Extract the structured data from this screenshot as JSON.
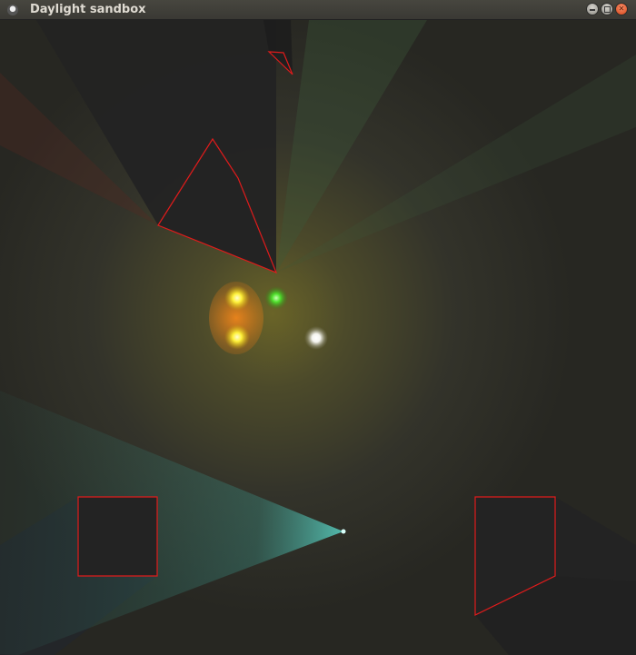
{
  "window": {
    "title": "Daylight sandbox",
    "app_icon": "app-icon",
    "controls": [
      {
        "name": "minimize-button",
        "icon": "minimize-icon"
      },
      {
        "name": "maximize-button",
        "icon": "maximize-icon"
      },
      {
        "name": "close-button",
        "icon": "close-icon"
      }
    ]
  },
  "scene": {
    "background_color": "#2a2a22",
    "obstacle_outline_color": "#e01b1b",
    "obstacle_fill_color": "#232323",
    "lights": [
      {
        "name": "yellow-light-top",
        "color": "#fff23a"
      },
      {
        "name": "green-light",
        "color": "#4fe02c"
      },
      {
        "name": "yellow-light-bottom",
        "color": "#fff23a"
      },
      {
        "name": "white-light",
        "color": "#ffffff"
      },
      {
        "name": "cyan-spotlight",
        "color": "#5fe8d8"
      }
    ]
  }
}
